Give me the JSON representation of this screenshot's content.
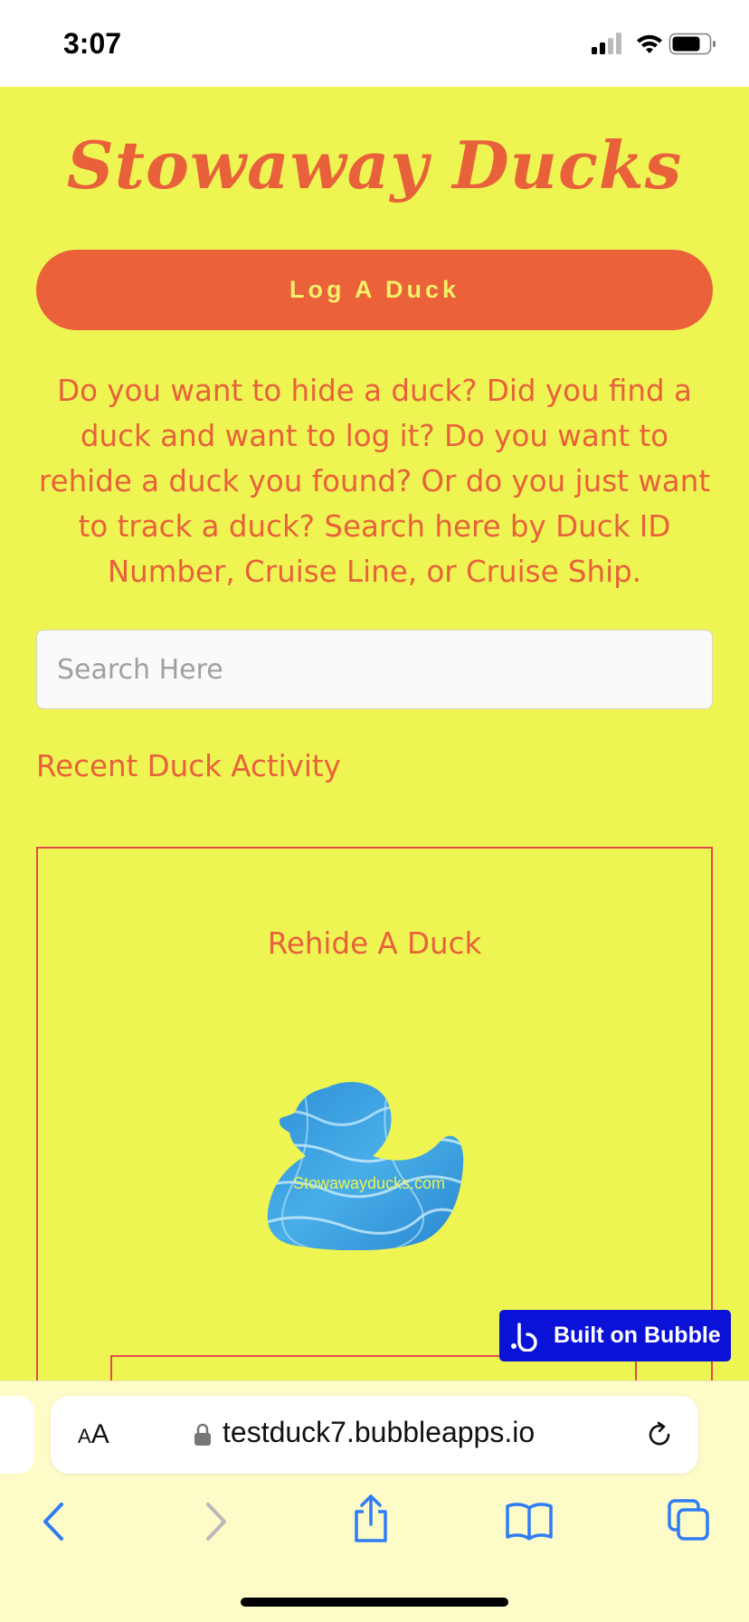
{
  "status_bar": {
    "time": "3:07"
  },
  "page": {
    "title": "Stowaway Ducks",
    "log_button_label": "Log A Duck",
    "intro_text": "Do you want to hide a duck? Did you find a duck and want to log it? Do you want to rehide a duck you found? Or do you just want to track a duck? Search here by Duck ID Number, Cruise Line, or Cruise Ship.",
    "search_placeholder": "Search Here",
    "search_value": "",
    "recent_heading": "Recent Duck Activity",
    "card": {
      "title": "Rehide A Duck",
      "image_watermark": "Stowawayducks.com"
    }
  },
  "bubble_badge": {
    "label": "Built on Bubble"
  },
  "browser": {
    "text_size_small": "A",
    "text_size_big": "A",
    "url": "testduck7.bubbleapps.io",
    "toolbar_icons": [
      "back-icon",
      "forward-icon",
      "share-icon",
      "bookmarks-icon",
      "tabs-icon"
    ]
  },
  "colors": {
    "background": "#eef553",
    "accent": "#ea613a",
    "card_border": "#e44a50",
    "bubble_blue": "#0a12d8",
    "safari_link": "#2f7cf6"
  }
}
